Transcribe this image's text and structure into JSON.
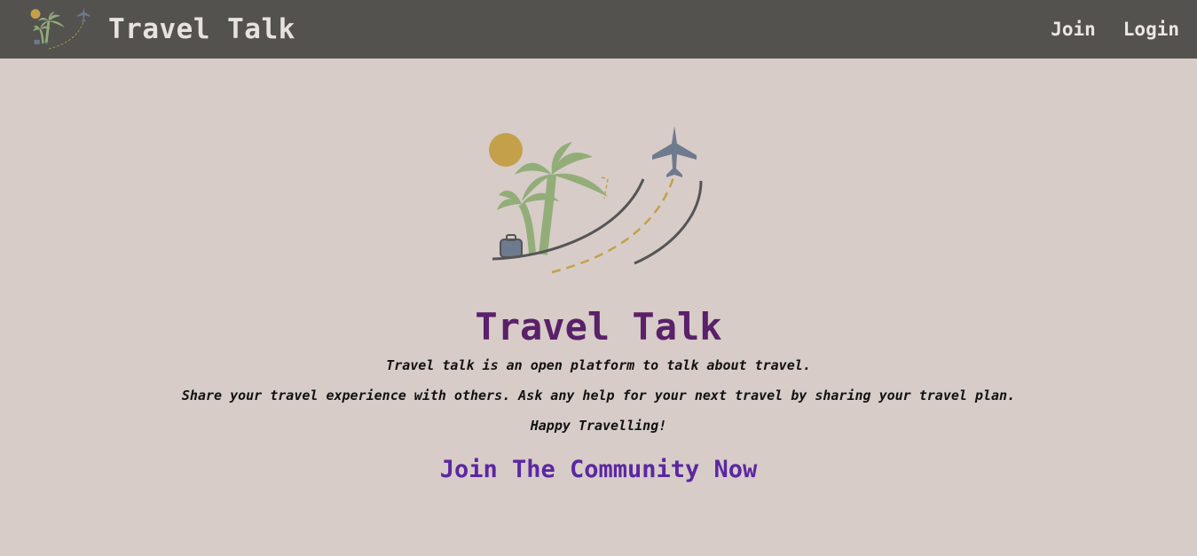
{
  "navbar": {
    "brand_title": "Travel Talk",
    "links": [
      {
        "label": "Join"
      },
      {
        "label": "Login"
      }
    ]
  },
  "hero": {
    "title": "Travel Talk",
    "lines": [
      "Travel talk is an open platform to talk about travel.",
      "Share your travel experience with others. Ask any help for your next travel by sharing your travel plan.",
      "Happy Travelling!"
    ],
    "cta_label": "Join The Community Now"
  },
  "colors": {
    "page_background": "#d7ccc8",
    "navbar_background": "#53524f",
    "hero_title": "#5a2069",
    "cta": "#5b27a1",
    "sun": "#c4a04a",
    "palm": "#93ad79",
    "plane": "#6e7a8e"
  },
  "icons": {
    "logo": "travel-logo-icon (sun, palm trees, suitcase, airplane, dashed flight path)"
  }
}
